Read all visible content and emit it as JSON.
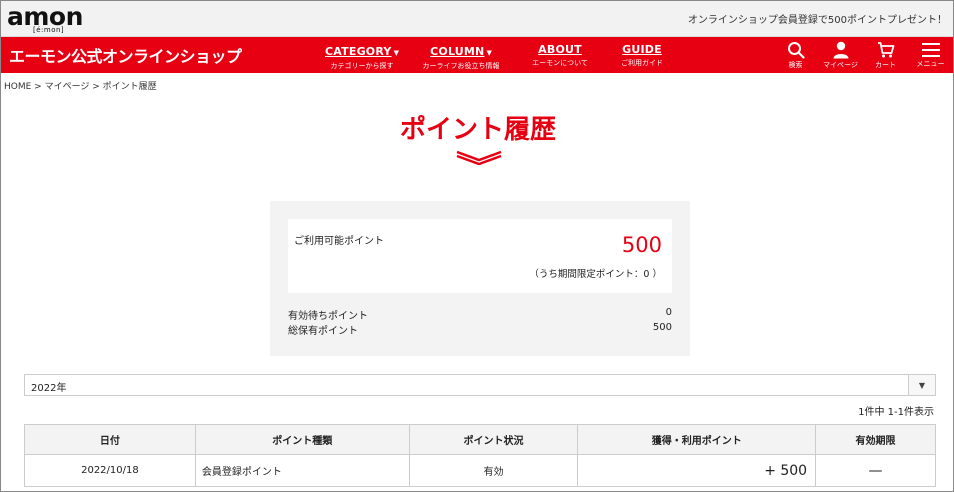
{
  "topbar": {
    "logo": "amon",
    "logo_sub": "[é:mon]",
    "promo": "オンラインショップ会員登録で500ポイントプレゼント！"
  },
  "navbar": {
    "brand": "エーモン公式オンラインショップ",
    "items": [
      {
        "en": "CATEGORY",
        "jp": "カテゴリーから探す",
        "has_caret": true
      },
      {
        "en": "COLUMN",
        "jp": "カーライフお役立ち情報",
        "has_caret": true
      },
      {
        "en": "ABOUT",
        "jp": "エーモンについて",
        "has_caret": false
      },
      {
        "en": "GUIDE",
        "jp": "ご利用ガイド",
        "has_caret": false
      }
    ],
    "icons": [
      {
        "label": "検索",
        "icon": "search-icon"
      },
      {
        "label": "マイページ",
        "icon": "user-icon"
      },
      {
        "label": "カート",
        "icon": "cart-icon"
      },
      {
        "label": "メニュー",
        "icon": "menu-icon"
      }
    ],
    "color": "#e60012"
  },
  "breadcrumb": "HOME > マイページ > ポイント履歴",
  "page": {
    "title": "ポイント履歴"
  },
  "points": {
    "available_label": "ご利用可能ポイント",
    "available_value": "500",
    "limited_note": "（うち期間限定ポイント：0 ）",
    "pending_label": "有効待ちポイント",
    "pending_value": "0",
    "total_label": "総保有ポイント",
    "total_value": "500"
  },
  "filter": {
    "year": "2022年"
  },
  "count_text": "1件中 1-1件表示",
  "table": {
    "headers": [
      "日付",
      "ポイント種類",
      "ポイント状況",
      "獲得・利用ポイント",
      "有効期限"
    ],
    "rows": [
      {
        "date": "2022/10/18",
        "type": "会員登録ポイント",
        "status": "有効",
        "amount": "+ 500",
        "expiry": "—"
      }
    ]
  }
}
